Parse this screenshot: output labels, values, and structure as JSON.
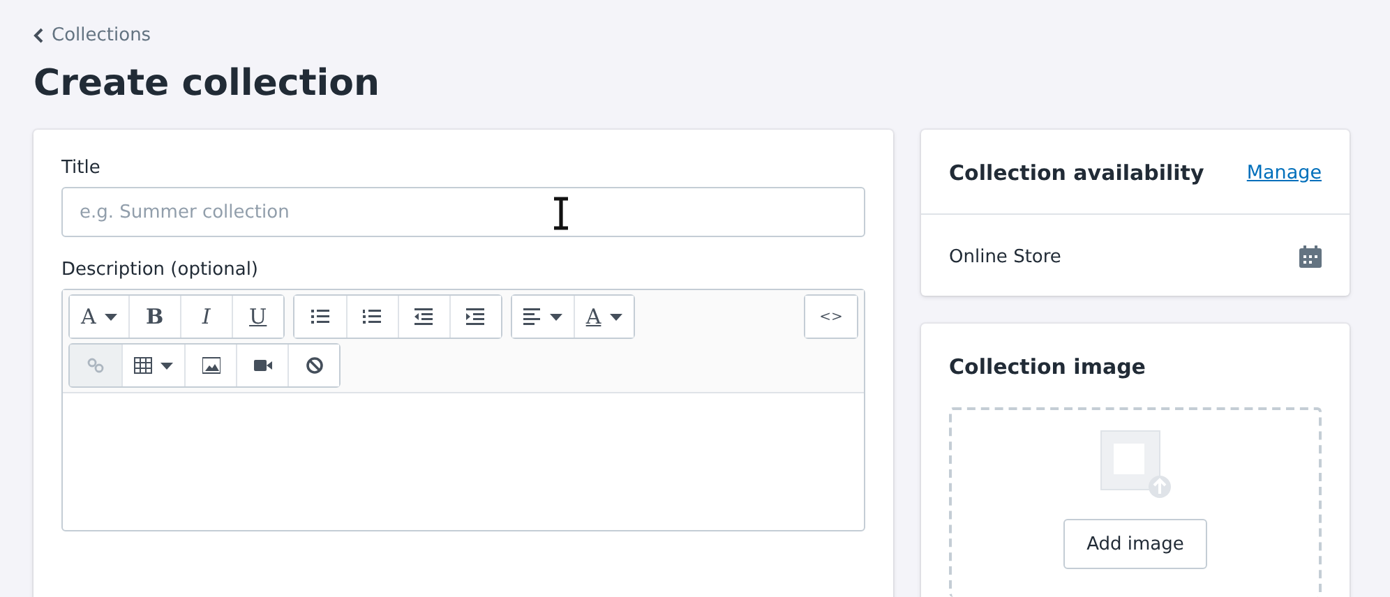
{
  "breadcrumb": {
    "label": "Collections"
  },
  "page_title": "Create collection",
  "title_field": {
    "label": "Title",
    "placeholder": "e.g. Summer collection"
  },
  "description": {
    "label": "Description (optional)",
    "toolbar_rows": [
      [
        {
          "items": [
            {
              "label": "A",
              "kind": "plain",
              "caret": true
            },
            {
              "label": "B",
              "kind": "bold",
              "caret": false
            },
            {
              "label": "I",
              "kind": "italic",
              "caret": false
            },
            {
              "label": "U",
              "kind": "underline",
              "caret": false
            }
          ]
        },
        {
          "items": [
            {
              "caret": false
            },
            {
              "caret": false
            },
            {
              "caret": false
            },
            {
              "caret": false
            }
          ]
        },
        {
          "items": [
            {
              "caret": true
            },
            {
              "label": "A",
              "kind": "underline",
              "caret": true
            }
          ]
        },
        {
          "items": [
            {
              "label": "<>",
              "kind": "code",
              "caret": false
            }
          ]
        }
      ],
      [
        {
          "items": [
            {
              "caret": false,
              "disabled": true
            },
            {
              "caret": true
            },
            {
              "caret": false
            },
            {
              "caret": false
            },
            {
              "caret": false
            }
          ]
        }
      ]
    ]
  },
  "availability": {
    "title": "Collection availability",
    "action": "Manage",
    "channels": [
      {
        "name": "Online Store"
      }
    ]
  },
  "image": {
    "title": "Collection image",
    "button": "Add image"
  }
}
